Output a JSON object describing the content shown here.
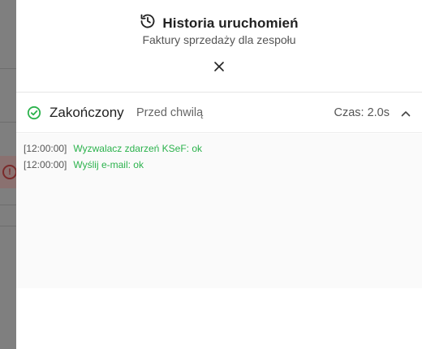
{
  "drawer": {
    "title": "Historia uruchomień",
    "subtitle": "Faktury sprzedaży dla zespołu",
    "title_icon": "history-icon",
    "close_icon": "close-icon"
  },
  "run": {
    "status": "Zakończony",
    "status_icon": "check-circle-icon",
    "status_color": "#2bb24c",
    "time": "Przed chwilą",
    "duration": "Czas: 2.0s",
    "collapse_icon": "chevron-up-icon",
    "logs": [
      {
        "timestamp": "[12:00:00]",
        "message": "Wyzwalacz zdarzeń KSeF: ok"
      },
      {
        "timestamp": "[12:00:00]",
        "message": "Wyślij e-mail: ok"
      }
    ]
  },
  "background": {
    "alert_icon": "error-icon",
    "alert_color": "#7a2a2a"
  }
}
